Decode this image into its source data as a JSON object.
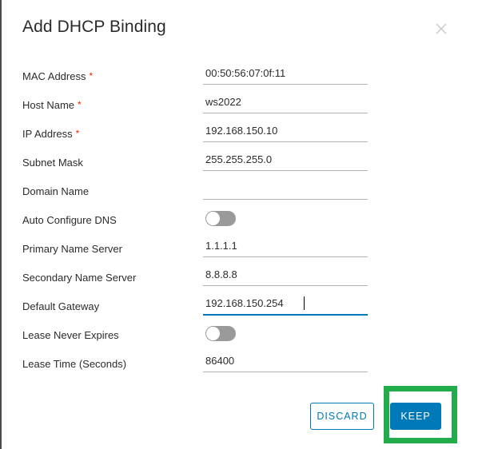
{
  "dialog": {
    "title": "Add DHCP Binding",
    "close_icon": "close-icon"
  },
  "form": {
    "fields": [
      {
        "label": "MAC Address",
        "required": true,
        "type": "text",
        "value": "00:50:56:07:0f:11",
        "focused": false
      },
      {
        "label": "Host Name",
        "required": true,
        "type": "text",
        "value": "ws2022",
        "focused": false
      },
      {
        "label": "IP Address",
        "required": true,
        "type": "text",
        "value": "192.168.150.10",
        "focused": false
      },
      {
        "label": "Subnet Mask",
        "required": false,
        "type": "text",
        "value": "255.255.255.0",
        "focused": false
      },
      {
        "label": "Domain Name",
        "required": false,
        "type": "text",
        "value": "",
        "focused": false
      },
      {
        "label": "Auto Configure DNS",
        "required": false,
        "type": "toggle",
        "value": "off",
        "focused": false
      },
      {
        "label": "Primary Name Server",
        "required": false,
        "type": "text",
        "value": "1.1.1.1",
        "focused": false
      },
      {
        "label": "Secondary Name Server",
        "required": false,
        "type": "text",
        "value": "8.8.8.8",
        "focused": false
      },
      {
        "label": "Default Gateway",
        "required": false,
        "type": "text",
        "value": "192.168.150.254",
        "focused": true
      },
      {
        "label": "Lease Never Expires",
        "required": false,
        "type": "toggle",
        "value": "off",
        "focused": false
      },
      {
        "label": "Lease Time (Seconds)",
        "required": false,
        "type": "text",
        "value": "86400",
        "focused": false
      }
    ],
    "required_marker": "*"
  },
  "footer": {
    "discard_label": "Discard",
    "keep_label": "Keep"
  },
  "annotation": {
    "target": "keep-button",
    "color": "#22ac4b"
  },
  "colors": {
    "accent": "#0079b8",
    "required": "#e62700",
    "highlight": "#22ac4b",
    "toggle_off": "#9a9a9a"
  }
}
